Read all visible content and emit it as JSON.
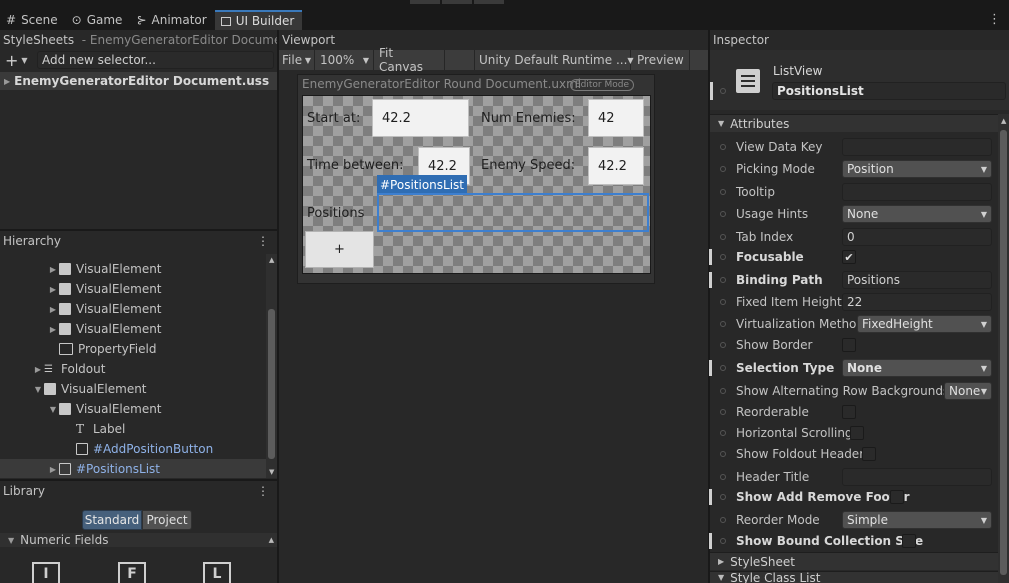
{
  "tabs": [
    {
      "label": "Scene",
      "icon": "scene-icon"
    },
    {
      "label": "Game",
      "icon": "gamepad-icon"
    },
    {
      "label": "Animator",
      "icon": "animator-icon"
    },
    {
      "label": "UI Builder",
      "icon": "ui-builder-icon"
    }
  ],
  "stylesheets": {
    "header": "StyleSheets",
    "subtitle": "- EnemyGeneratorEditor Document",
    "selector_placeholder": "Add new selector...",
    "uss_file": "EnemyGeneratorEditor Document.uss"
  },
  "viewport": {
    "header": "Viewport",
    "file": "File",
    "zoom": "100%",
    "fit": "Fit Canvas",
    "theme": "Unity Default Runtime ...",
    "preview": "Preview",
    "doc_title": "EnemyGeneratorEditor Round Document.uxml",
    "editor_mode": "Editor Mode",
    "canvas": {
      "start_label": "Start at:",
      "start_value": "42.2",
      "num_enemies_label": "Num Enemies:",
      "num_enemies_value": "42",
      "time_between_label": "Time between:",
      "time_between_value": "42.2",
      "enemy_speed_label": "Enemy Speed:",
      "enemy_speed_value": "42.2",
      "positions_label": "Positions",
      "selected_tag": "#PositionsList",
      "add_button": "+"
    }
  },
  "hierarchy": {
    "header": "Hierarchy",
    "items": [
      {
        "label": "VisualElement",
        "icon": "visual-element-icon"
      },
      {
        "label": "VisualElement",
        "icon": "visual-element-icon"
      },
      {
        "label": "VisualElement",
        "icon": "visual-element-icon"
      },
      {
        "label": "VisualElement",
        "icon": "visual-element-icon"
      },
      {
        "label": "PropertyField",
        "icon": "property-field-icon"
      },
      {
        "label": "Foldout",
        "icon": "foldout-icon"
      },
      {
        "label": "VisualElement",
        "icon": "visual-element-icon"
      },
      {
        "label": "VisualElement",
        "icon": "visual-element-icon"
      },
      {
        "label": "Label",
        "icon": "label-icon"
      },
      {
        "label": "#AddPositionButton",
        "icon": "button-icon"
      },
      {
        "label": "#PositionsList",
        "icon": "list-view-icon"
      }
    ]
  },
  "library": {
    "header": "Library",
    "standard": "Standard",
    "project": "Project",
    "section": "Numeric Fields"
  },
  "inspector": {
    "header": "Inspector",
    "type": "ListView",
    "name": "PositionsList",
    "attributes_header": "Attributes",
    "rows": [
      {
        "label": "View Data Key",
        "kind": "text",
        "value": ""
      },
      {
        "label": "Picking Mode",
        "kind": "dropdown",
        "value": "Position"
      },
      {
        "label": "Tooltip",
        "kind": "text",
        "value": ""
      },
      {
        "label": "Usage Hints",
        "kind": "dropdown",
        "value": "None"
      },
      {
        "label": "Tab Index",
        "kind": "text",
        "value": "0"
      },
      {
        "label": "Focusable",
        "kind": "check",
        "value": "✔"
      },
      {
        "label": "Binding Path",
        "kind": "text",
        "value": "Positions"
      },
      {
        "label": "Fixed Item Height",
        "kind": "text",
        "value": "22"
      },
      {
        "label": "Virtualization Method",
        "kind": "dropdown",
        "value": "FixedHeight"
      },
      {
        "label": "Show Border",
        "kind": "check",
        "value": ""
      },
      {
        "label": "Selection Type",
        "kind": "dropdown",
        "value": "None"
      },
      {
        "label": "Show Alternating Row Backgrounds",
        "kind": "dropdown",
        "value": "None"
      },
      {
        "label": "Reorderable",
        "kind": "check",
        "value": ""
      },
      {
        "label": "Horizontal Scrolling",
        "kind": "check",
        "value": ""
      },
      {
        "label": "Show Foldout Header",
        "kind": "check",
        "value": ""
      },
      {
        "label": "Header Title",
        "kind": "text",
        "value": ""
      },
      {
        "label": "Show Add Remove Footer",
        "kind": "check",
        "value": ""
      },
      {
        "label": "Reorder Mode",
        "kind": "dropdown",
        "value": "Simple"
      },
      {
        "label": "Show Bound Collection Size",
        "kind": "check",
        "value": ""
      }
    ],
    "stylesheet_header": "StyleSheet",
    "style_class_header": "Style Class List"
  }
}
